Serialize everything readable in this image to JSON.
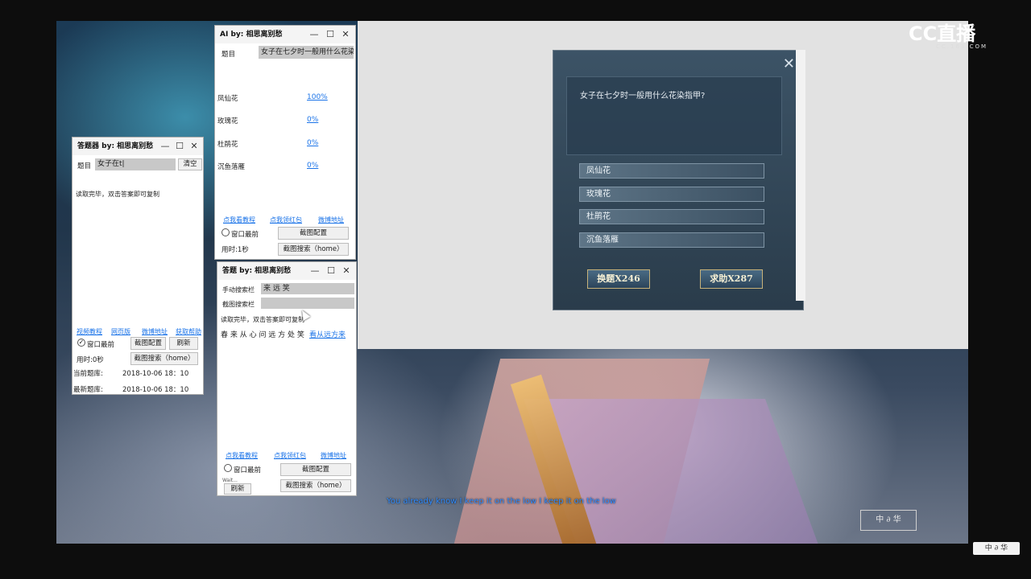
{
  "overlay": {
    "logo_text": "CC直播",
    "logo_sub": "CC.163.COM",
    "subtitle": "You already know I keep it on the low I keep it on the low",
    "seal_text": "中 ∂ 华",
    "corner_badge": "中 ∂ 华"
  },
  "ai_window": {
    "title": "AI by: 相思离别愁",
    "question_label": "题目",
    "question_value": "女子在七夕时一般用什么花染",
    "answers": [
      {
        "label": "凤仙花",
        "percent": "100%"
      },
      {
        "label": "玫瑰花",
        "percent": "0%"
      },
      {
        "label": "杜鹃花",
        "percent": "0%"
      },
      {
        "label": "沉鱼落雁",
        "percent": "0%"
      }
    ],
    "links": [
      "点我看教程",
      "点我领红包",
      "微博地址"
    ],
    "topmost_label": "窗口最前",
    "config_button": "截图配置",
    "time_used": "用时:1秒",
    "search_button": "截图搜索（home）"
  },
  "helper_window": {
    "title": "答题器 by: 相思离别愁",
    "question_label": "题目",
    "question_value": "女子在t|",
    "clear_button": "清空",
    "status": "读取完毕，双击答案即可复制",
    "links": [
      "视频教程",
      "网页版",
      "微博地址",
      "获取帮助"
    ],
    "topmost_label": "窗口最前",
    "config_button": "截图配置",
    "refresh_button": "刷新",
    "time_used": "用时:0秒",
    "search_button": "截图搜索（home）",
    "current_db_label": "当前题库:",
    "current_db_value": "2018-10-06 18：10",
    "latest_db_label": "最新题库:",
    "latest_db_value": "2018-10-06 18：10"
  },
  "answer_window": {
    "title": "答题 by: 相思离别愁",
    "manual_label": "手动搜索栏",
    "manual_value": "来 远 笑",
    "capture_label": "截图搜索栏",
    "capture_value": "",
    "status": "读取完毕，双击答案即可复制",
    "result_text": "春 来 从 心 问 远 方 处 笑",
    "result_link": "看从远方来",
    "links": [
      "点我看教程",
      "点我领红包",
      "微博地址"
    ],
    "topmost_label": "窗口最前",
    "config_button": "截图配置",
    "wait_label": "Wait...",
    "refresh_button": "刷新",
    "search_button": "截图搜索（home）"
  },
  "game_dialog": {
    "question": "女子在七夕时一般用什么花染指甲?",
    "options": [
      "凤仙花",
      "玫瑰花",
      "杜鹃花",
      "沉鱼落雁"
    ],
    "change_button": "换题X246",
    "help_button": "求助X287"
  }
}
